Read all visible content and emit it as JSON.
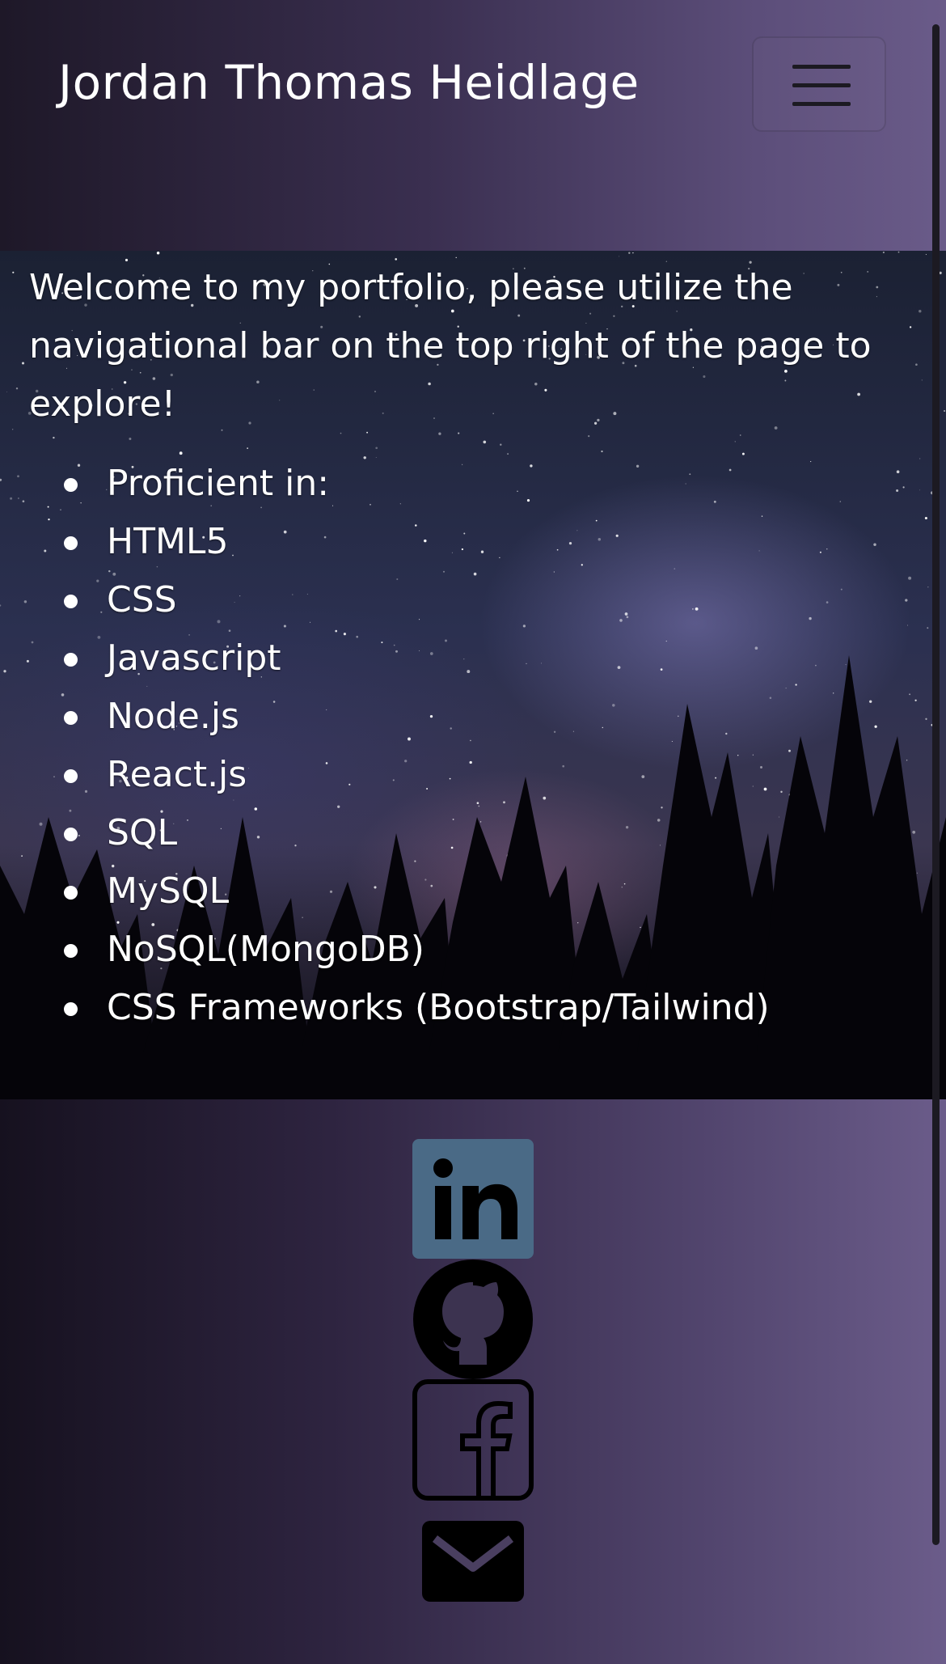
{
  "header": {
    "brand": "Jordan Thomas Heidlage",
    "menu_icon": "hamburger-menu-icon"
  },
  "hero": {
    "intro": "Welcome to my portfolio, please utilize the navigational bar on the top right of the page to explore!",
    "skills": [
      "Proficient in:",
      "HTML5",
      "CSS",
      "Javascript",
      "Node.js",
      "React.js",
      "SQL",
      "MySQL",
      "NoSQL(MongoDB)",
      "CSS Frameworks (Bootstrap/Tailwind)"
    ]
  },
  "social": {
    "icons": [
      "linkedin-icon",
      "github-icon",
      "facebook-icon",
      "mail-icon"
    ],
    "linkedin_text": "in"
  },
  "colors": {
    "linkedin": "#4a6a86",
    "icon_dark": "#000000",
    "text": "#ffffff"
  }
}
